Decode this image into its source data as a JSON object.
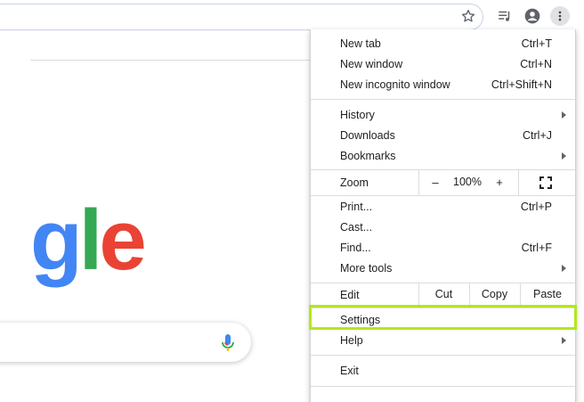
{
  "toolbar": {
    "icons": [
      "star-icon",
      "reading-list-icon",
      "account-icon",
      "menu-icon"
    ]
  },
  "logo": {
    "part_g": "g",
    "part_l": "l",
    "part_e": "e"
  },
  "menu": {
    "new_tab": {
      "label": "New tab",
      "accel": "Ctrl+T"
    },
    "new_window": {
      "label": "New window",
      "accel": "Ctrl+N"
    },
    "new_incognito": {
      "label": "New incognito window",
      "accel": "Ctrl+Shift+N"
    },
    "history": {
      "label": "History"
    },
    "downloads": {
      "label": "Downloads",
      "accel": "Ctrl+J"
    },
    "bookmarks": {
      "label": "Bookmarks"
    },
    "zoom": {
      "label": "Zoom",
      "minus": "–",
      "level": "100%",
      "plus": "+"
    },
    "print": {
      "label": "Print...",
      "accel": "Ctrl+P"
    },
    "cast": {
      "label": "Cast..."
    },
    "find": {
      "label": "Find...",
      "accel": "Ctrl+F"
    },
    "more_tools": {
      "label": "More tools"
    },
    "edit": {
      "label": "Edit",
      "cut": "Cut",
      "copy": "Copy",
      "paste": "Paste"
    },
    "settings": {
      "label": "Settings"
    },
    "help": {
      "label": "Help"
    },
    "exit": {
      "label": "Exit"
    }
  },
  "colors": {
    "highlight": "#b4e61e",
    "logo_blue": "#4285f4",
    "logo_green": "#34a853",
    "logo_red": "#ea4335"
  }
}
